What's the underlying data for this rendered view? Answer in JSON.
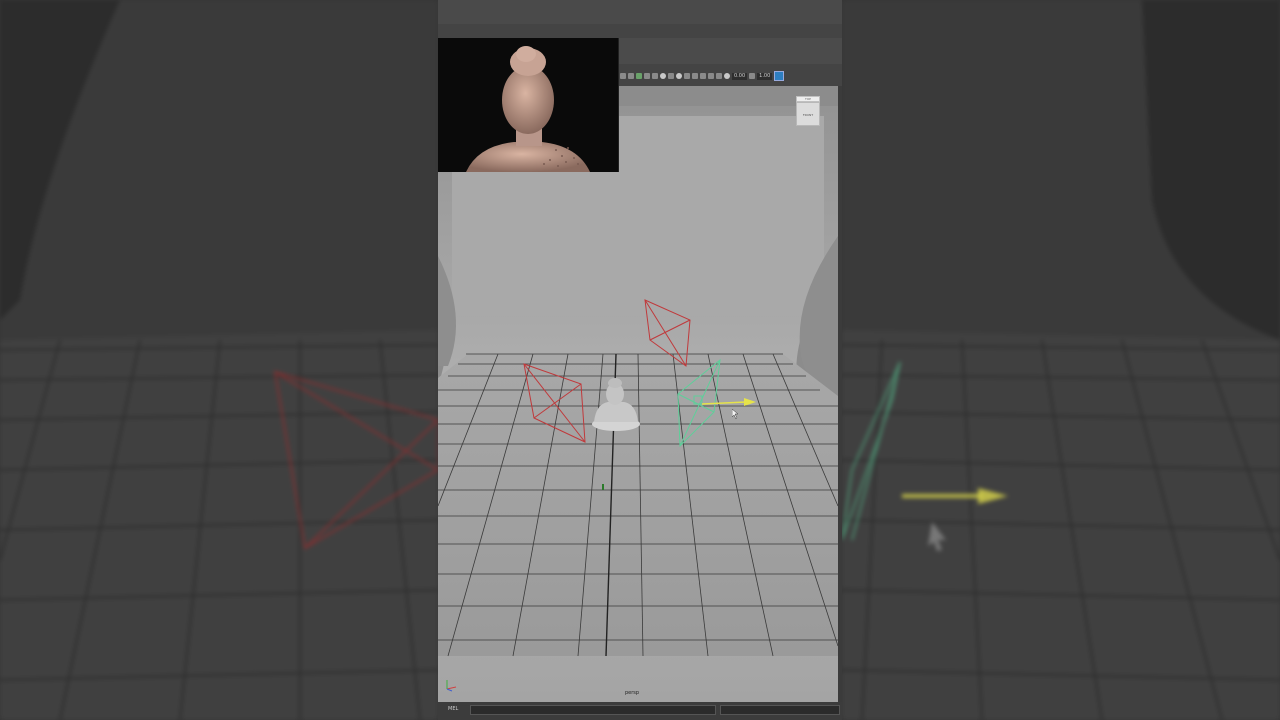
{
  "viewport": {
    "camera_label": "persp",
    "viewcube": {
      "top_label": "TOP",
      "front_label": "FRONT"
    }
  },
  "toolbar": {
    "field_1": "0.00",
    "field_2": "1.00"
  },
  "command_line": {
    "label": "MEL"
  },
  "colors": {
    "viewport_bg": "#8a8a8a",
    "grid": "#333333",
    "camera_red": "#c0393b",
    "camera_green": "#5fcf9a",
    "manipulator_yellow": "#e6e34a"
  }
}
